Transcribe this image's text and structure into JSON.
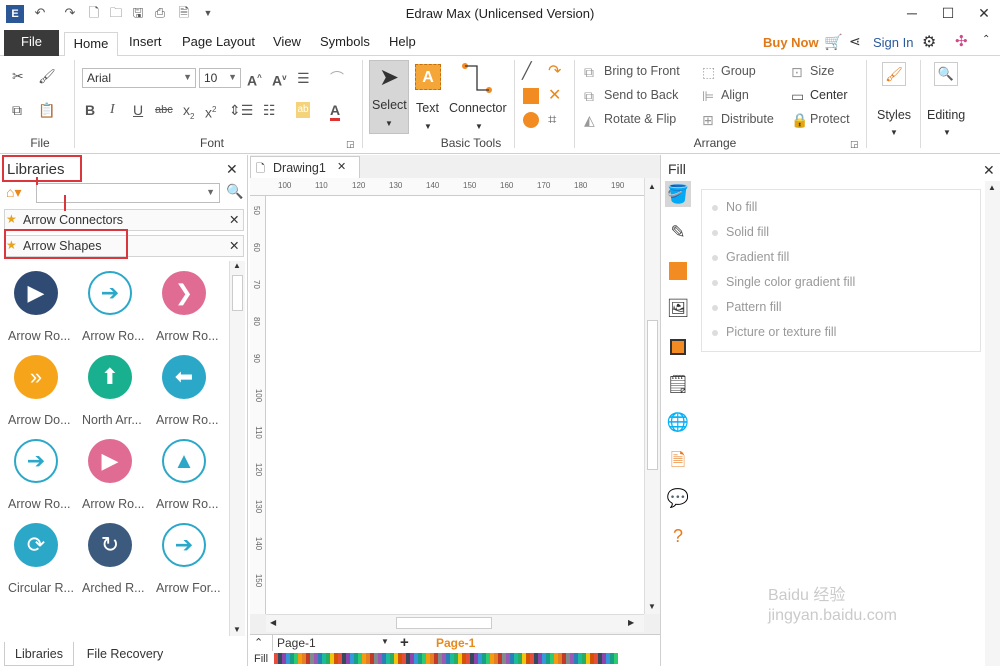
{
  "window": {
    "title": "Edraw Max (Unlicensed Version)",
    "minimize": "─",
    "maximize": "☐",
    "close": "✕"
  },
  "tabs": [
    "File",
    "Home",
    "Insert",
    "Page Layout",
    "View",
    "Symbols",
    "Help"
  ],
  "account": {
    "buy_now": "Buy Now",
    "sign_in": "Sign In"
  },
  "ribbon": {
    "file_group_label": "File",
    "font": {
      "family": "Arial",
      "size": "10",
      "group_label": "Font"
    },
    "basic_tools": {
      "select": "Select",
      "text": "Text",
      "connector": "Connector",
      "group_label": "Basic Tools"
    },
    "arrange": {
      "bring_to_front": "Bring to Front",
      "send_to_back": "Send to Back",
      "rotate_flip": "Rotate & Flip",
      "group": "Group",
      "align": "Align",
      "distribute": "Distribute",
      "size": "Size",
      "center": "Center",
      "protect": "Protect",
      "group_label": "Arrange"
    },
    "styles": "Styles",
    "editing": "Editing"
  },
  "libraries": {
    "title": "Libraries",
    "search_placeholder": "",
    "sections": [
      {
        "name": "Arrow Connectors"
      },
      {
        "name": "Arrow Shapes"
      }
    ],
    "shapes": [
      {
        "label": "Arrow Ro...",
        "color": "#2f4a73",
        "glyph": "▶"
      },
      {
        "label": "Arrow Ro...",
        "color": "#ffffff",
        "glyph": "➔"
      },
      {
        "label": "Arrow Ro...",
        "color": "#e06c94",
        "glyph": "❯"
      },
      {
        "label": "Arrow Do...",
        "color": "#f6a51a",
        "glyph": "»"
      },
      {
        "label": "North Arr...",
        "color": "#19b08f",
        "glyph": "⬆"
      },
      {
        "label": "Arrow Ro...",
        "color": "#2ba7c8",
        "glyph": "⬅"
      },
      {
        "label": "Arrow Ro...",
        "color": "#ffffff",
        "glyph": "➔"
      },
      {
        "label": "Arrow Ro...",
        "color": "#e06c94",
        "glyph": "▶"
      },
      {
        "label": "Arrow Ro...",
        "color": "#ffffff",
        "glyph": "▲"
      },
      {
        "label": "Circular R...",
        "color": "#2ba7c8",
        "glyph": "⟳"
      },
      {
        "label": "Arched R...",
        "color": "#3c5a7e",
        "glyph": "↻"
      },
      {
        "label": "Arrow For...",
        "color": "#ffffff",
        "glyph": "➔"
      }
    ],
    "bottom_tabs": [
      "Libraries",
      "File Recovery"
    ]
  },
  "document": {
    "tab": "Drawing1",
    "h_ruler": [
      "100",
      "110",
      "120",
      "130",
      "140",
      "150",
      "160",
      "170",
      "180",
      "190"
    ],
    "v_ruler": [
      "50",
      "60",
      "70",
      "80",
      "90",
      "100",
      "110",
      "120",
      "130",
      "140",
      "150"
    ],
    "page_selector": "Page-1",
    "active_page": "Page-1",
    "fill_label": "Fill"
  },
  "fill_panel": {
    "title": "Fill",
    "options": [
      "No fill",
      "Solid fill",
      "Gradient fill",
      "Single color gradient fill",
      "Pattern fill",
      "Picture or texture fill"
    ]
  },
  "watermark": "Baidu 经验 jingyan.baidu.com"
}
